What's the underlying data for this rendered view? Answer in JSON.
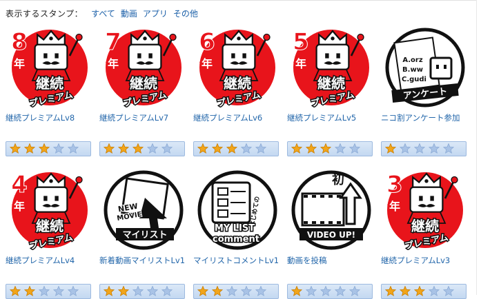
{
  "filter": {
    "label": "表示するスタンプ：",
    "options": [
      "すべて",
      "動画",
      "アプリ",
      "その他"
    ]
  },
  "stamps": [
    {
      "title": "継続プレミアムLv8",
      "rating": 3,
      "kind": "premium",
      "level": "8",
      "year": "年",
      "line1": "継続",
      "line2": "プレミアム"
    },
    {
      "title": "継続プレミアムLv7",
      "rating": 3,
      "kind": "premium",
      "level": "7",
      "year": "年",
      "line1": "継続",
      "line2": "プレミアム"
    },
    {
      "title": "継続プレミアムLv6",
      "rating": 3,
      "kind": "premium",
      "level": "6",
      "year": "年",
      "line1": "継続",
      "line2": "プレミアム"
    },
    {
      "title": "継続プレミアムLv5",
      "rating": 3,
      "kind": "premium",
      "level": "5",
      "year": "年",
      "line1": "継続",
      "line2": "プレミアム"
    },
    {
      "title": "ニコ割アンケート参加",
      "rating": 1,
      "kind": "survey",
      "l1": "A.orz",
      "l2": "B.ww",
      "l3": "C.gudi",
      "banner": "アンケート"
    },
    {
      "title": "継続プレミアムLv4",
      "rating": 2,
      "kind": "premium",
      "level": "4",
      "year": "年",
      "line1": "継続",
      "line2": "プレミアム"
    },
    {
      "title": "新着動画マイリストLv1",
      "rating": 2,
      "kind": "newmovie",
      "l1": "NEW",
      "l2": "MOVIE",
      "l3": "マイリスト"
    },
    {
      "title": "マイリストコメントLv1",
      "rating": 2,
      "kind": "mylist",
      "l1": "はじめての",
      "l2": "MY LIST",
      "l3": "comment"
    },
    {
      "title": "動画を投稿",
      "rating": 1,
      "kind": "videoup",
      "l1": "初",
      "l2": "VIDEO UP!"
    },
    {
      "title": "継続プレミアムLv3",
      "rating": 3,
      "kind": "premium",
      "level": "3",
      "year": "年",
      "line1": "継続",
      "line2": "プレミアム"
    }
  ],
  "colors": {
    "red": "#e8141b",
    "link": "#2266aa",
    "star": "#f1a51b",
    "starOff": "#a9c3e6"
  }
}
